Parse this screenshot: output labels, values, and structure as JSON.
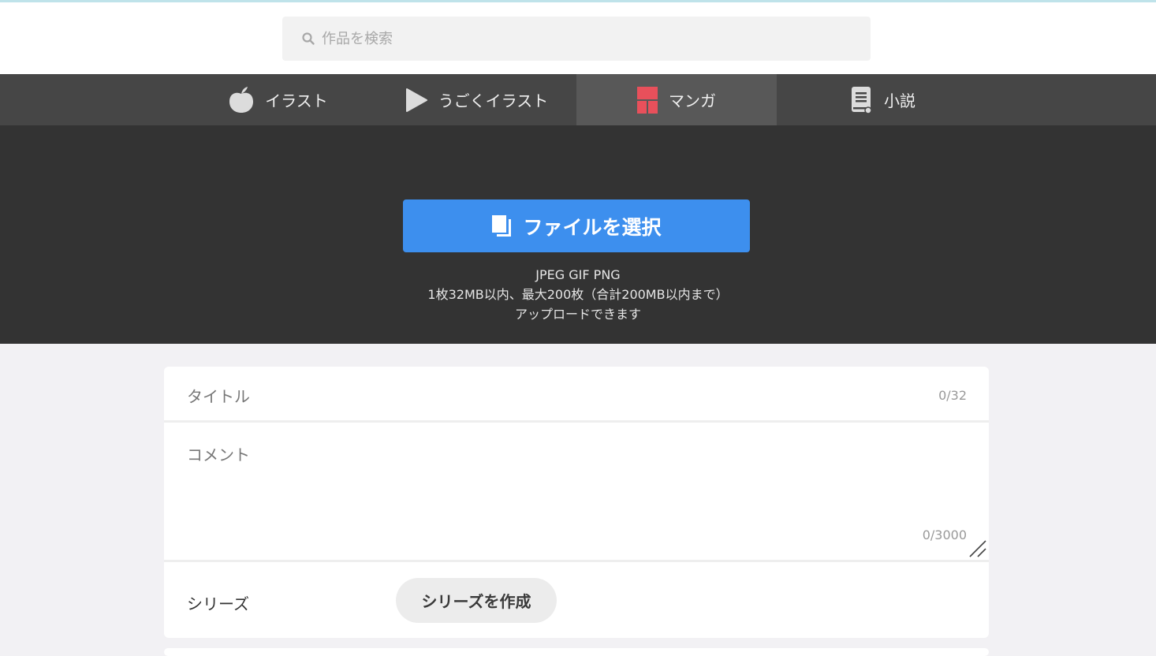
{
  "search": {
    "placeholder": "作品を検索"
  },
  "tabs": [
    {
      "label": "イラスト",
      "icon": "apple-icon"
    },
    {
      "label": "うごくイラスト",
      "icon": "play-icon"
    },
    {
      "label": "マンガ",
      "icon": "manga-panels-icon",
      "active": true
    },
    {
      "label": "小説",
      "icon": "book-icon"
    }
  ],
  "upload": {
    "button_label": "ファイルを選択",
    "formats": "JPEG GIF PNG",
    "limits": "1枚32MB以内、最大200枚（合計200MB以内まで）",
    "note": "アップロードできます"
  },
  "form": {
    "title_label": "タイトル",
    "title_counter": "0/32",
    "comment_label": "コメント",
    "comment_counter": "0/3000",
    "series_label": "シリーズ",
    "series_button": "シリーズを作成"
  },
  "colors": {
    "accent": "#3d8fee",
    "manga_icon": "#e8505b",
    "tab_bar": "#464646",
    "upload_bg": "#333333"
  }
}
